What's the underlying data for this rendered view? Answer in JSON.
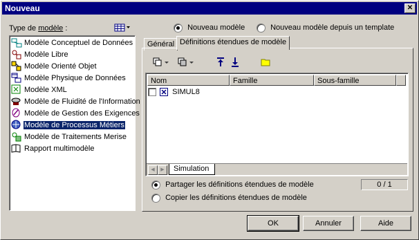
{
  "window": {
    "title": "Nouveau",
    "close_glyph": "✕"
  },
  "left": {
    "type_label_pre": "Type de ",
    "type_label_u": "modèle",
    "type_label_post": " :",
    "view_icon": "list-view-icon",
    "items": [
      {
        "label": "Modèle Conceptuel de Données",
        "icon": "conceptual-model-icon",
        "color": "#008080"
      },
      {
        "label": "Modèle Libre",
        "icon": "free-model-icon",
        "color": "#800000"
      },
      {
        "label": "Modèle Orienté Objet",
        "icon": "object-model-icon",
        "color": "#c0a000"
      },
      {
        "label": "Modèle Physique de Données",
        "icon": "physical-model-icon",
        "color": "#000080"
      },
      {
        "label": "Modèle XML",
        "icon": "xml-model-icon",
        "color": "#008000"
      },
      {
        "label": "Modèle de Fluidité de l'Information",
        "icon": "information-flow-icon",
        "color": "#404040"
      },
      {
        "label": "Modèle de Gestion des Exigences",
        "icon": "requirements-icon",
        "color": "#800080"
      },
      {
        "label": "Modèle de Processus Métiers",
        "icon": "business-process-icon",
        "color": "#000080",
        "selected": true
      },
      {
        "label": "Modèle de Traitements Merise",
        "icon": "merise-icon",
        "color": "#008000"
      },
      {
        "label": "Rapport multimodèle",
        "icon": "report-icon",
        "color": "#404040"
      }
    ]
  },
  "radios": {
    "new_model": "Nouveau modèle",
    "new_from_template": "Nouveau modèle depuis un template"
  },
  "tabs": {
    "general": "Général",
    "extended": "Définitions étendues de modèle"
  },
  "grid": {
    "columns": [
      "Nom",
      "Famille",
      "Sous-famille"
    ],
    "rows": [
      {
        "name": "SIMUL8",
        "family": "",
        "subfamily": "",
        "checked": false
      }
    ],
    "sheet_tab": "Simulation"
  },
  "options": {
    "share": "Partager les définitions étendues de modèle",
    "copy": "Copier les définitions étendues de modèle",
    "counter": "0 / 1"
  },
  "buttons": {
    "ok": "OK",
    "cancel": "Annuler",
    "help": "Aide"
  }
}
